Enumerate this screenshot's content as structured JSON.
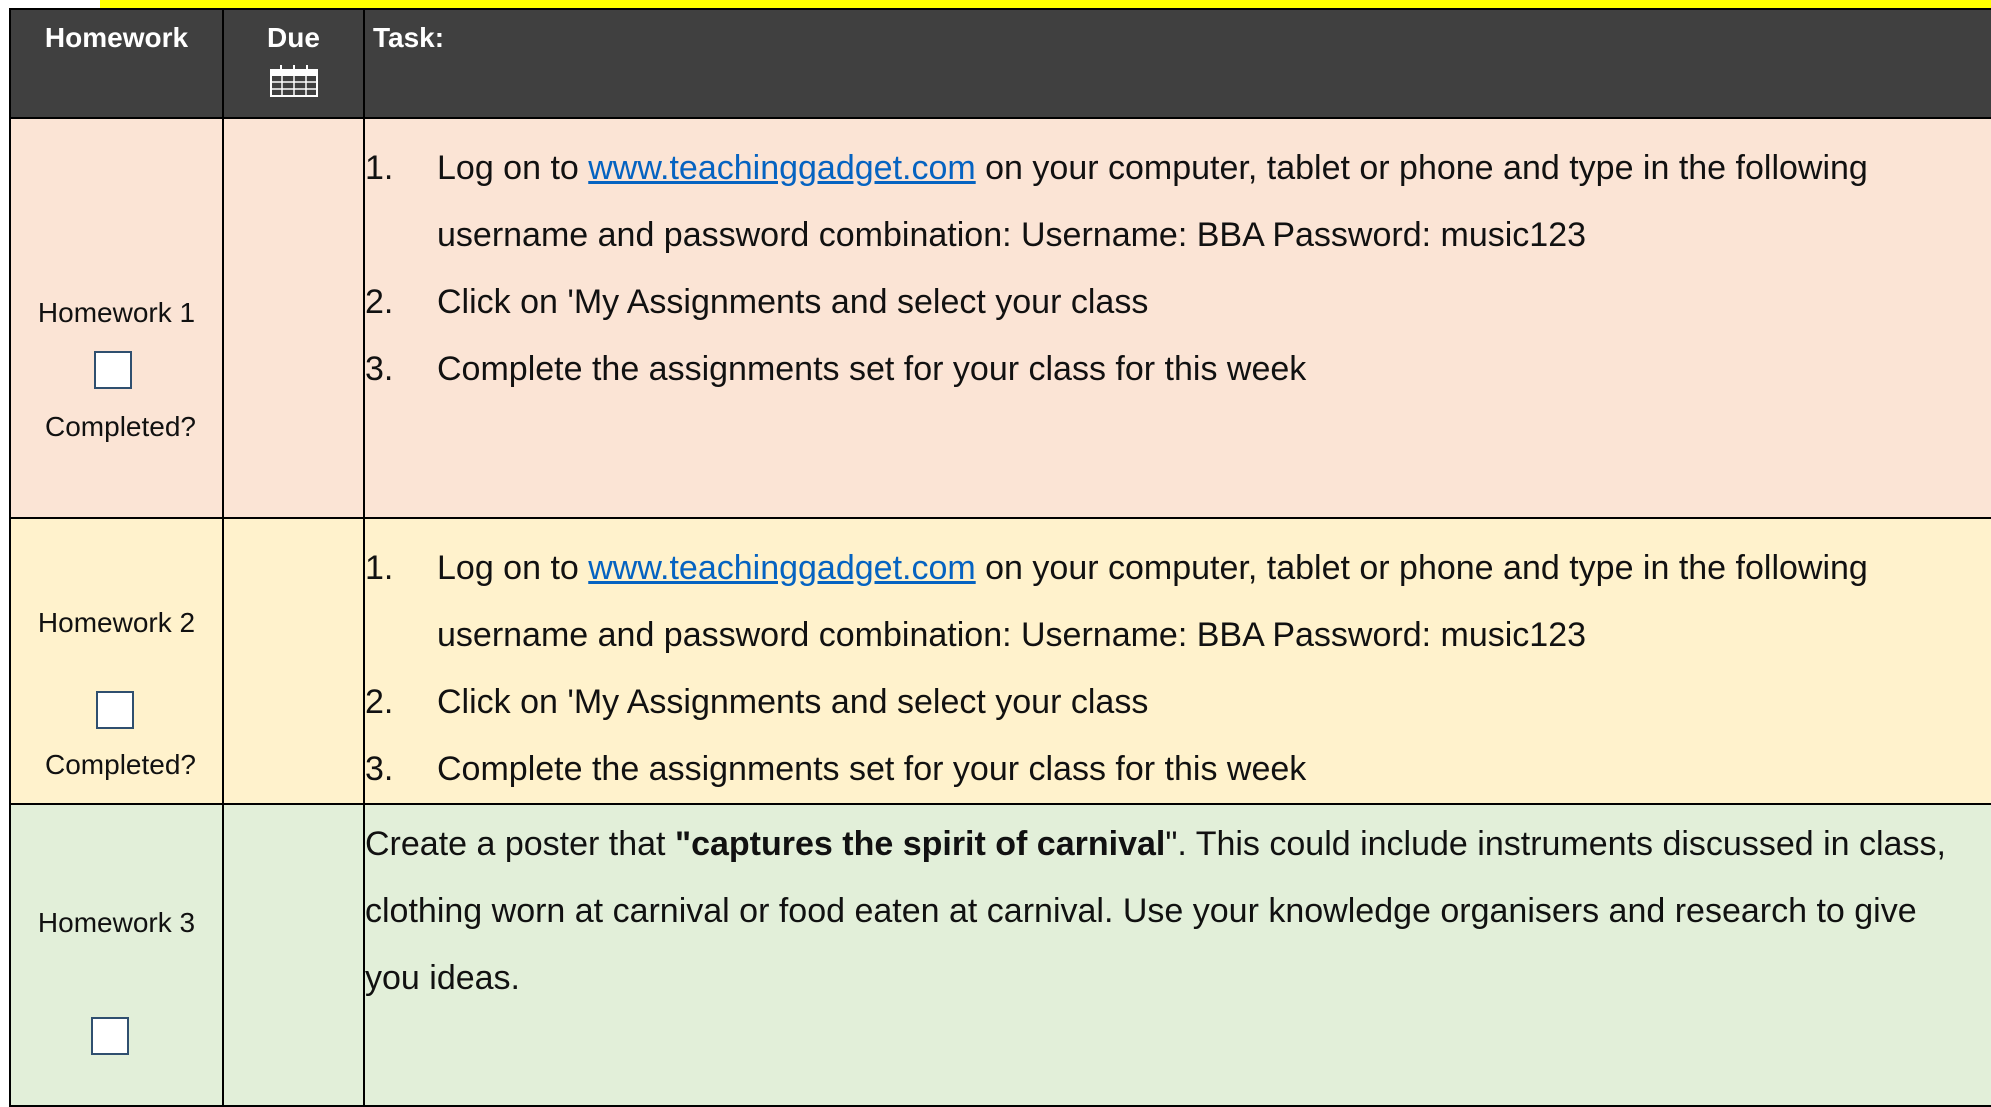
{
  "header": {
    "homework": "Homework",
    "due": "Due",
    "task": "Task:"
  },
  "colors": {
    "header_bg": "#404040",
    "row1_bg": "#fbe4d5",
    "row2_bg": "#fff2cc",
    "row3_bg": "#e2efd9",
    "link": "#0563c1",
    "highlight": "#ffff00"
  },
  "rows": [
    {
      "label": "Homework 1",
      "completed_label": "Completed?",
      "steps": [
        {
          "num": "1.",
          "pre": "Log on to ",
          "link": "www.teachinggadget.com",
          "post": " on your computer, tablet or phone and type in the following username and password combination: Username: BBA   Password: music123"
        },
        {
          "num": "2.",
          "text": "Click on 'My Assignments and select your class"
        },
        {
          "num": "3.",
          "text": "Complete the assignments set for your class for this week"
        }
      ]
    },
    {
      "label": "Homework 2",
      "completed_label": "Completed?",
      "steps": [
        {
          "num": "1.",
          "pre": "Log on to ",
          "link": "www.teachinggadget.com",
          "post": " on your computer, tablet or phone and type in the following username and password combination: Username: BBA   Password: music123"
        },
        {
          "num": "2.",
          "text": "Click on 'My Assignments and select your class"
        },
        {
          "num": "3.",
          "text": "Complete the assignments set for your class for this week"
        }
      ]
    },
    {
      "label": "Homework 3",
      "task_pre": "Create a poster that ",
      "task_bold": "\"captures the spirit of carnival",
      "task_post": "\". This could include instruments discussed in class, clothing worn at carnival or food eaten at carnival. Use your knowledge organisers and research to give you ideas."
    }
  ]
}
